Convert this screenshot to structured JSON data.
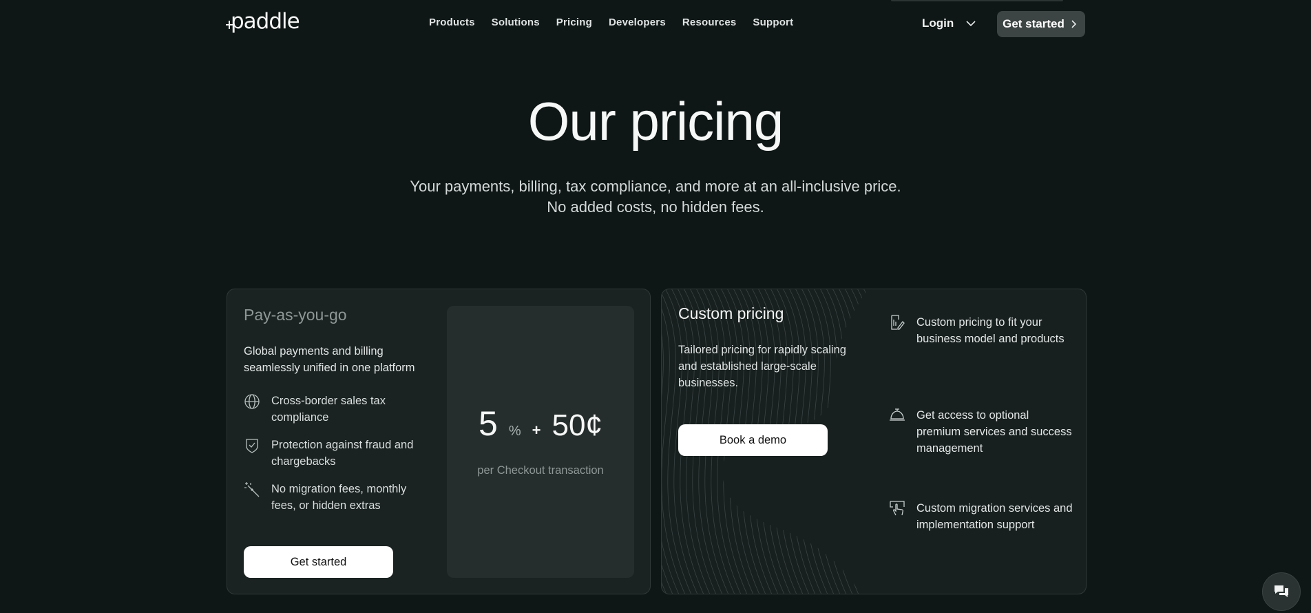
{
  "header": {
    "logo_text": "paddle",
    "nav": [
      "Products",
      "Solutions",
      "Pricing",
      "Developers",
      "Resources",
      "Support"
    ],
    "login_label": "Login",
    "cta_label": "Get started"
  },
  "hero": {
    "title": "Our pricing",
    "subtitle_line1": "Your payments, billing, tax compliance, and more at an all-inclusive price.",
    "subtitle_line2": "No added costs, no hidden fees."
  },
  "payg": {
    "name": "Pay-as-you-go",
    "description": "Global payments and billing seamlessly unified in one platform",
    "features": [
      {
        "icon": "globe-icon",
        "text": "Cross-border sales tax compliance"
      },
      {
        "icon": "shield-check-icon",
        "text": "Protection against fraud and chargebacks"
      },
      {
        "icon": "magic-wand-icon",
        "text": "No migration fees, monthly fees, or hidden extras"
      }
    ],
    "button_label": "Get started",
    "price": {
      "percent": "5",
      "percent_sign": "%",
      "plus": "+",
      "cents": "50¢",
      "note": "per Checkout transaction"
    }
  },
  "custom": {
    "name": "Custom pricing",
    "description": "Tailored pricing for rapidly scaling and established large-scale businesses.",
    "button_label": "Book a demo",
    "features": [
      {
        "icon": "document-edit-icon",
        "text": "Custom pricing to fit your business model and products"
      },
      {
        "icon": "service-bell-icon",
        "text": "Get access to optional premium services and success management"
      },
      {
        "icon": "migration-tap-icon",
        "text": "Custom migration services and implementation support"
      }
    ]
  },
  "colors": {
    "background": "#0f1616",
    "card": "#1b2222",
    "accent_button": "#3d4444"
  }
}
